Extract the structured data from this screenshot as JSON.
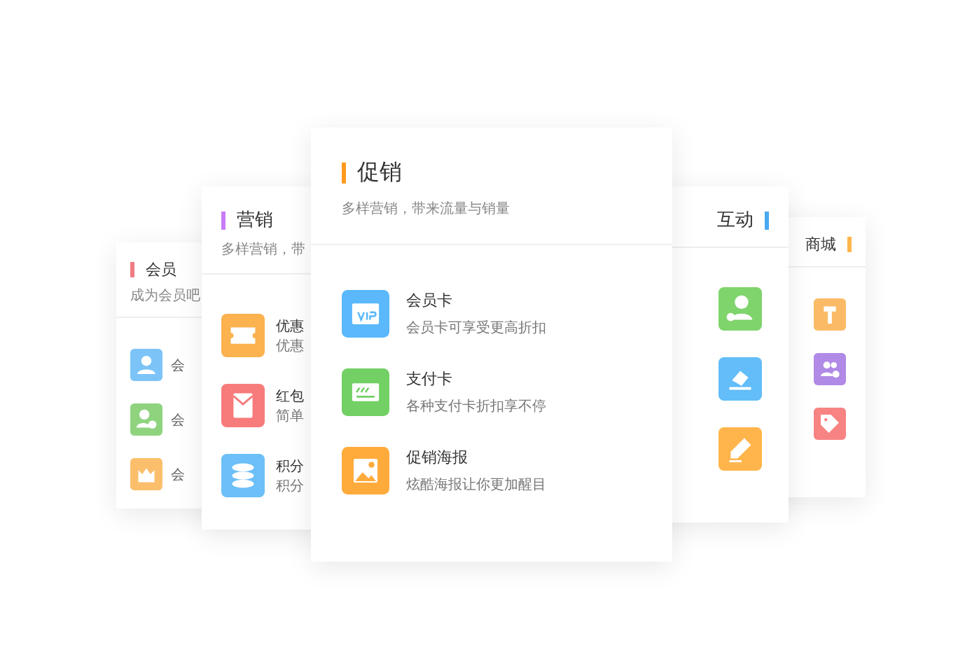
{
  "cards": [
    {
      "title": "会员",
      "subtitle": "成为会员吧",
      "color": "#f07c82",
      "items": [
        {
          "title": "会",
          "color": "#7cc4f8"
        },
        {
          "title": "会",
          "color": "#8fd37f"
        },
        {
          "title": "会",
          "color": "#fbbf6b"
        }
      ]
    },
    {
      "title": "营销",
      "subtitle": "多样营销，带",
      "color": "#c77cf5",
      "items": [
        {
          "title": "优惠",
          "desc": "优惠",
          "color": "#fbb24f"
        },
        {
          "title": "红包",
          "desc": "简单",
          "color": "#f77b7b"
        },
        {
          "title": "积分",
          "desc": "积分",
          "color": "#6cbff8"
        }
      ]
    },
    {
      "title": "促销",
      "subtitle": "多样营销，带来流量与销量",
      "color": "#ff9a1e",
      "items": [
        {
          "title": "会员卡",
          "desc": "会员卡可享受更高折扣",
          "color": "#5ab8fb"
        },
        {
          "title": "支付卡",
          "desc": "各种支付卡折扣享不停",
          "color": "#72d064"
        },
        {
          "title": "促销海报",
          "desc": "炫酷海报让你更加醒目",
          "color": "#ffab3b"
        }
      ]
    },
    {
      "title": "互动",
      "color": "#4aa8f0",
      "items": [
        {
          "color": "#7fd46c"
        },
        {
          "color": "#62bdf9"
        },
        {
          "color": "#ffb54c"
        }
      ]
    },
    {
      "title": "商城",
      "color": "#ffb54c",
      "items": [
        {
          "color": "#fbbb66"
        },
        {
          "color": "#b08ae6"
        },
        {
          "color": "#f88383"
        }
      ]
    }
  ]
}
